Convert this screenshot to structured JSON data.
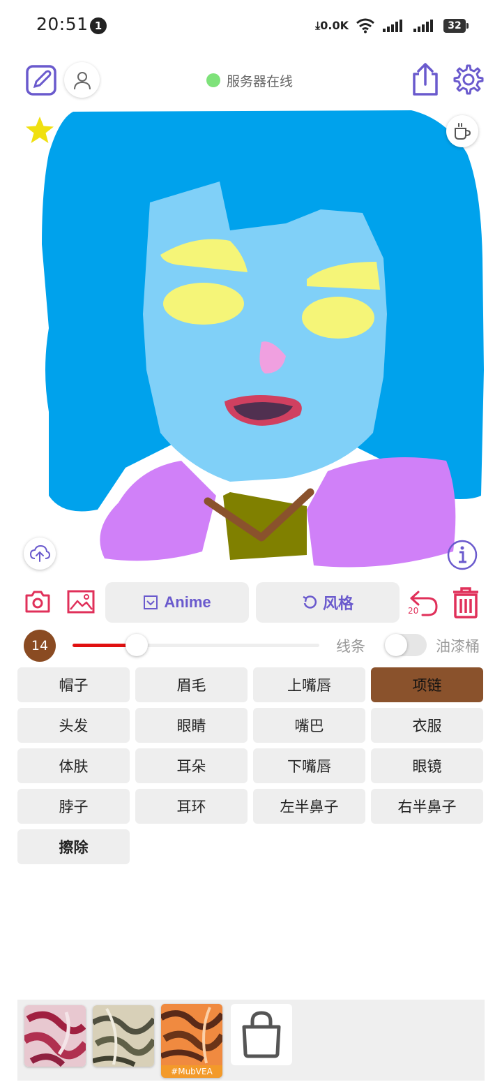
{
  "status_bar": {
    "time": "20:51",
    "notification_count": "1",
    "network_speed": "0.0K",
    "battery": "32"
  },
  "header": {
    "server_status": "服务器在线",
    "server_status_color": "#7ee27a",
    "icons": [
      "edit-icon",
      "user-icon",
      "share-icon",
      "settings-icon"
    ]
  },
  "canvas": {
    "floating_icons": [
      "star-icon",
      "coffee-icon",
      "cloud-upload-icon",
      "info-icon"
    ]
  },
  "toolbar": {
    "style_model_label": "Anime",
    "style_label": "风格",
    "undo_count": "20",
    "icons": [
      "camera-icon",
      "image-icon",
      "dropdown-icon",
      "refresh-icon",
      "undo-icon",
      "trash-icon"
    ]
  },
  "brush": {
    "size": "14",
    "size_level": 0.26,
    "mode_left_label": "线条",
    "mode_right_label": "油漆桶",
    "fill_mode_on": false,
    "accent_color": "#e01010",
    "selected_color": "#8a522c"
  },
  "parts": [
    {
      "label": "帽子"
    },
    {
      "label": "眉毛"
    },
    {
      "label": "上嘴唇"
    },
    {
      "label": "项链",
      "selected": true
    },
    {
      "label": "头发"
    },
    {
      "label": "眼睛"
    },
    {
      "label": "嘴巴"
    },
    {
      "label": "衣服"
    },
    {
      "label": "体肤"
    },
    {
      "label": "耳朵"
    },
    {
      "label": "下嘴唇"
    },
    {
      "label": "眼镜"
    },
    {
      "label": "脖子"
    },
    {
      "label": "耳环"
    },
    {
      "label": "左半鼻子"
    },
    {
      "label": "右半鼻子"
    },
    {
      "label": "擦除",
      "bold": true
    }
  ],
  "tray": {
    "selected_caption": "#MubVEA",
    "icons": [
      "shopping-bag-icon"
    ]
  }
}
